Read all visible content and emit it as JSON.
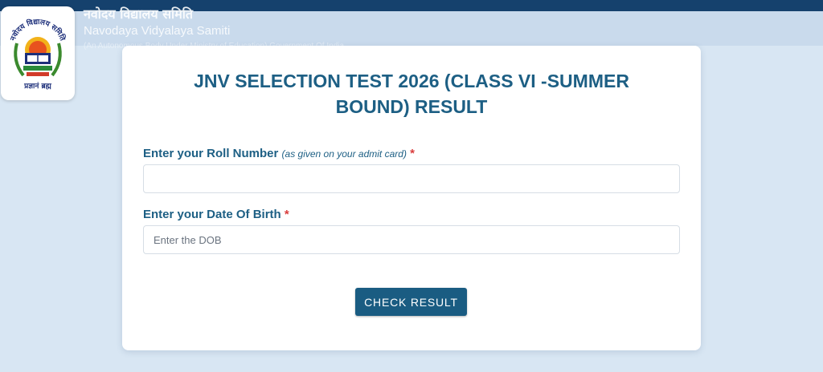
{
  "header": {
    "org_hindi": "नवोदय विद्यालय समिति",
    "org_english": "Navodaya Vidyalaya Samiti",
    "org_subtitle": "(An Autonomous Body Under Ministry of Education) Government Of India",
    "logo_icon": "nvs-emblem-logo",
    "logo_text_hindi_top": "नवोदय विद्यालय समिति",
    "logo_text_hindi_bottom": "प्रज्ञानं ब्रह्म"
  },
  "form": {
    "title": "JNV SELECTION TEST 2026 (CLASS VI -SUMMER BOUND) RESULT",
    "roll_label": "Enter your Roll Number",
    "roll_hint": "(as given on your admit card)",
    "roll_value": "",
    "roll_placeholder": "",
    "dob_label": "Enter your Date Of Birth",
    "dob_placeholder": "Enter the DOB",
    "required_mark": "*",
    "submit_label": "CHECK RESULT"
  },
  "colors": {
    "header_bar": "#15416d",
    "accent": "#1d5f84",
    "button": "#1a5c82",
    "required": "#d93c3c",
    "background": "#d8e6f3"
  }
}
